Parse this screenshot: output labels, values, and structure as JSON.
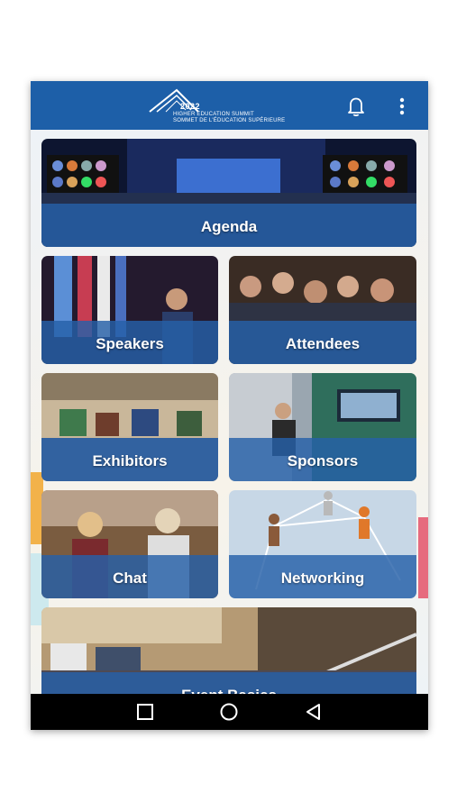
{
  "header": {
    "logo_year": "2022",
    "logo_line1": "HIGHER EDUCATION SUMMIT",
    "logo_line2": "SOMMET DE L'ÉDUCATION SUPÉRIEURE",
    "notification_icon": "bell-icon",
    "menu_icon": "more-vert-icon"
  },
  "tiles": [
    {
      "label": "Agenda",
      "icon": "agenda-photo"
    },
    {
      "label": "Speakers",
      "icon": "speakers-photo"
    },
    {
      "label": "Attendees",
      "icon": "attendees-photo"
    },
    {
      "label": "Exhibitors",
      "icon": "exhibitors-photo"
    },
    {
      "label": "Sponsors",
      "icon": "sponsors-photo"
    },
    {
      "label": "Chat",
      "icon": "chat-photo"
    },
    {
      "label": "Networking",
      "icon": "networking-photo"
    },
    {
      "label": "Event Basics",
      "icon": "event-basics-photo"
    }
  ],
  "colors": {
    "appbar": "#1d5fa8",
    "tile_band": "#2660a8",
    "navbar": "#000000"
  },
  "navbar": {
    "recents_icon": "square-icon",
    "home_icon": "circle-icon",
    "back_icon": "triangle-back-icon"
  }
}
